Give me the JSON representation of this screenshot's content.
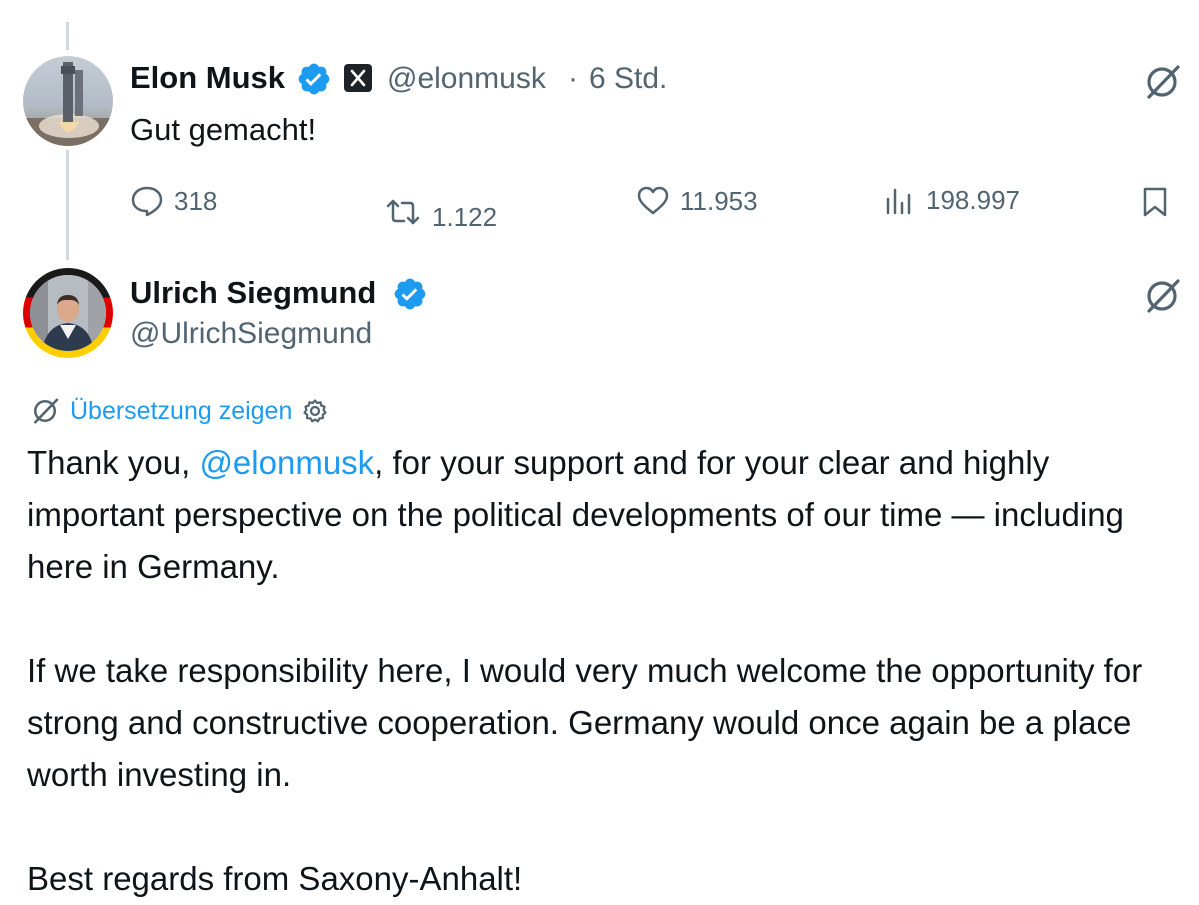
{
  "tweet1": {
    "name": "Elon Musk",
    "handle": "@elonmusk",
    "separator": "·",
    "time": "6 Std.",
    "text": "Gut gemacht!",
    "metrics": {
      "replies": "318",
      "retweets": "1.122",
      "likes": "11.953",
      "views": "198.997"
    }
  },
  "tweet2": {
    "name": "Ulrich Siegmund",
    "handle": "@UlrichSiegmund",
    "translate_label": "Übersetzung zeigen",
    "paragraph1": {
      "before": "Thank you, ",
      "mention": "@elonmusk",
      "after": ", for your support and for your clear and highly important perspective on the political developments of our time — including here in Germany."
    },
    "paragraph2": "If we take responsibility here, I would very much welcome the opportunity for strong and constructive cooperation. Germany would once again be a place worth investing in.",
    "paragraph3": "Best regards from Saxony-Anhalt!"
  },
  "colors": {
    "accent": "#1d9bf0",
    "muted": "#536471",
    "text": "#0f1419"
  }
}
